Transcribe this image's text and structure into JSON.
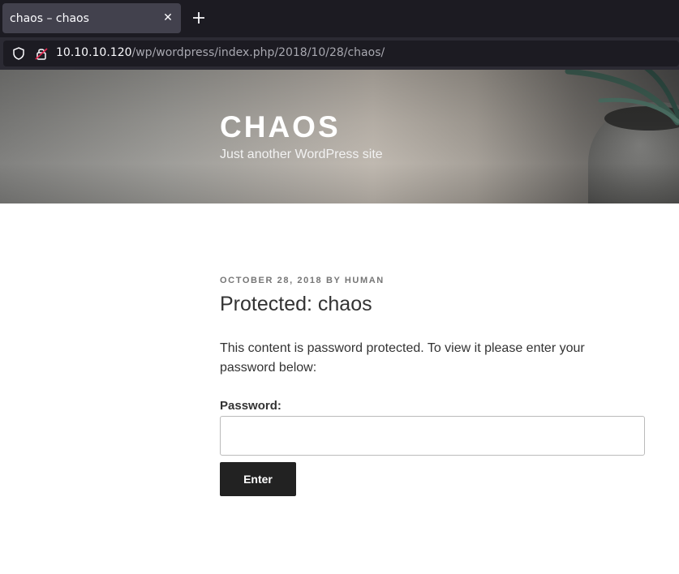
{
  "browser": {
    "tab_title": "chaos – chaos",
    "url_host": "10.10.10.120",
    "url_path": "/wp/wordpress/index.php/2018/10/28/chaos/"
  },
  "header": {
    "site_title": "CHAOS",
    "site_description": "Just another WordPress site"
  },
  "post": {
    "date": "OCTOBER 28, 2018",
    "by": "BY",
    "author": "HUMAN",
    "title": "Protected: chaos",
    "message": "This content is password protected. To view it please enter your password below:",
    "password_label": "Password:",
    "password_value": "",
    "submit_label": "Enter"
  },
  "icons": [
    "close-icon",
    "plus-icon",
    "shield-icon",
    "insecure-lock-icon"
  ]
}
